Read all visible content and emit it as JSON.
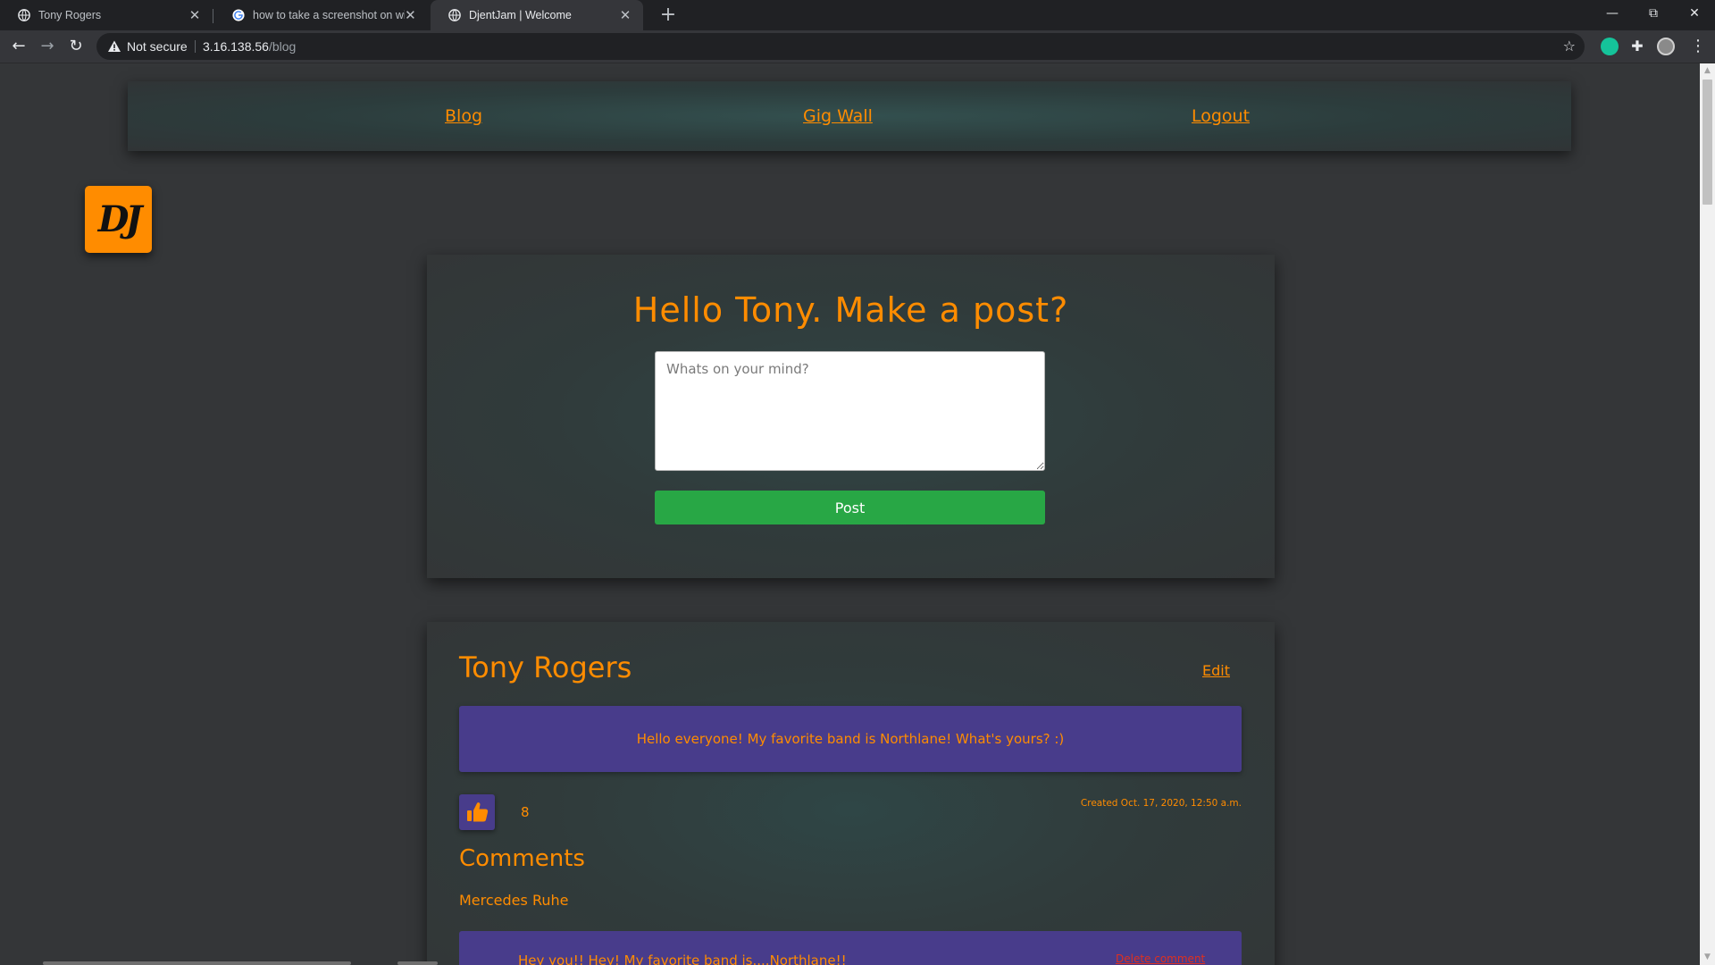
{
  "browser": {
    "tabs": [
      {
        "title": "Tony Rogers",
        "icon": "globe-icon",
        "active": false
      },
      {
        "title": "how to take a screenshot on windows",
        "icon": "google-icon",
        "active": false
      },
      {
        "title": "DjentJam | Welcome",
        "icon": "globe-icon",
        "active": true
      }
    ],
    "new_tab": "+",
    "address": {
      "security_label": "Not secure",
      "host": "3.16.138.56",
      "path": "/blog"
    }
  },
  "site_nav": {
    "blog": "Blog",
    "gig_wall": "Gig Wall",
    "logout": "Logout"
  },
  "logo": {
    "text": "DJ"
  },
  "post_form": {
    "heading": "Hello Tony. Make a post?",
    "placeholder": "Whats on your mind?",
    "value": "",
    "button": "Post",
    "button_color": "#28a745"
  },
  "post": {
    "author": "Tony Rogers",
    "edit": "Edit",
    "body": "Hello everyone! My favorite band is Northlane! What's yours? :)",
    "likes": "8",
    "created": "Created Oct. 17, 2020, 12:50 a.m.",
    "comments_heading": "Comments",
    "comments": [
      {
        "author": "Mercedes Ruhe",
        "text": "Hey you!! Hey! My favorite band is....Northlane!!",
        "delete": "Delete comment"
      }
    ]
  },
  "colors": {
    "accent": "#ff8c00",
    "panel": "#483c8b",
    "background": "#343638"
  }
}
